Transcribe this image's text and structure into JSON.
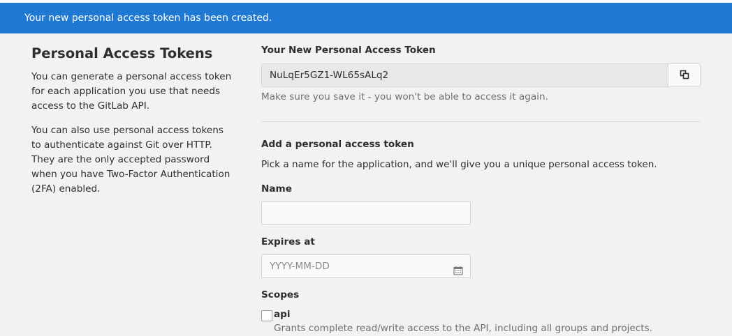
{
  "flash": {
    "message": "Your new personal access token has been created."
  },
  "sidebar": {
    "title": "Personal Access Tokens",
    "paragraph1": "You can generate a personal access token for each application you use that needs access to the GitLab API.",
    "paragraph2": "You can also use personal access tokens to authenticate against Git over HTTP. They are the only accepted password when you have Two-Factor Authentication (2FA) enabled."
  },
  "new_token": {
    "label": "Your New Personal Access Token",
    "value": "NuLqEr5GZ1-WL65sALq2",
    "help": "Make sure you save it - you won't be able to access it again.",
    "copy_icon": "copy-icon"
  },
  "add_token": {
    "heading": "Add a personal access token",
    "description": "Pick a name for the application, and we'll give you a unique personal access token.",
    "name_label": "Name",
    "name_value": "",
    "expires_label": "Expires at",
    "expires_placeholder": "YYYY-MM-DD",
    "calendar_icon": "calendar-icon",
    "scopes_label": "Scopes",
    "scopes": [
      {
        "name": "api",
        "checked": false,
        "description": "Grants complete read/write access to the API, including all groups and projects."
      }
    ]
  },
  "colors": {
    "flash_bg": "#1f78d1",
    "page_bg": "#f2f2f2"
  }
}
